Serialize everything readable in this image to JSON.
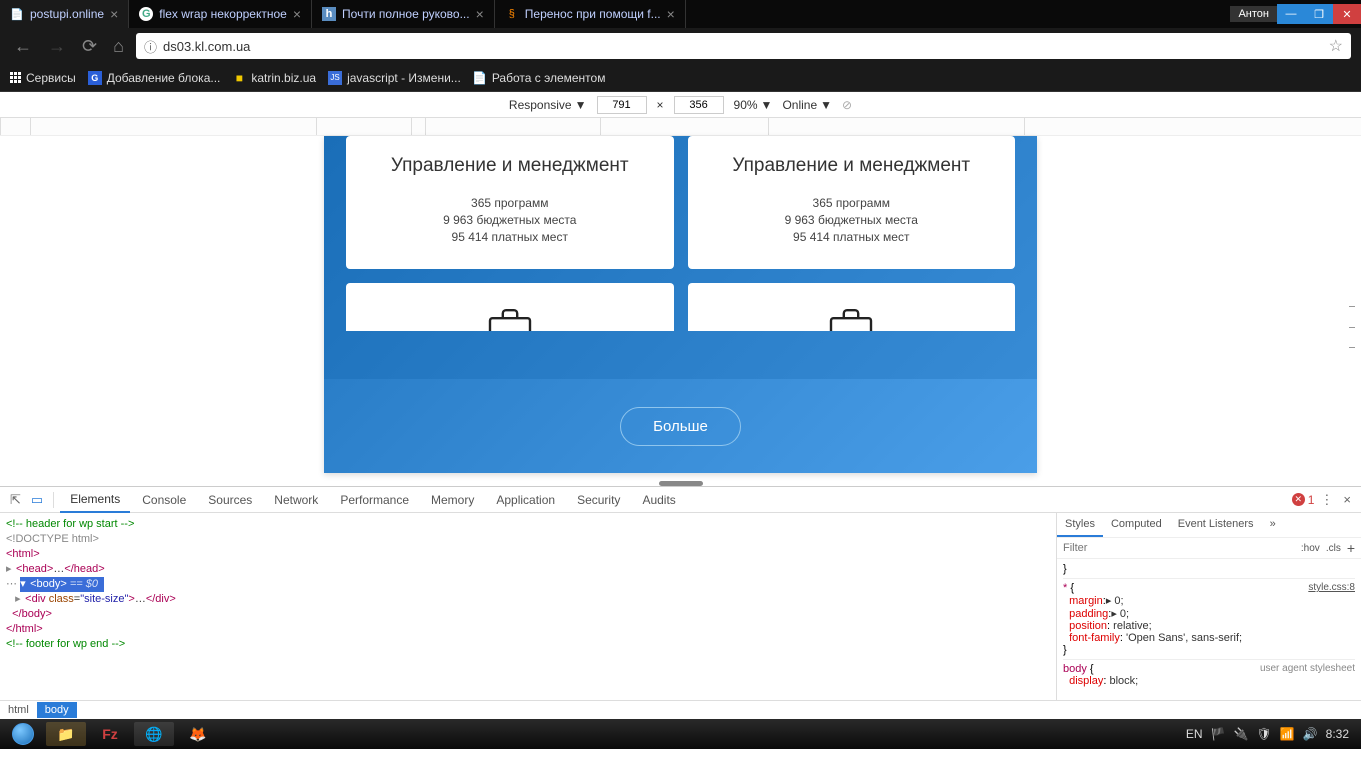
{
  "browser": {
    "tabs": [
      {
        "title": "postupi.online",
        "favicon": "📄",
        "color": "#4da0ff"
      },
      {
        "title": "flex wrap некорректное",
        "favicon": "G",
        "color": "#fff"
      },
      {
        "title": "Почти полное руково...",
        "favicon": "h",
        "color": "#fff"
      },
      {
        "title": "Перенос при помощи f...",
        "favicon": "§",
        "color": "#fff"
      }
    ],
    "user": "Антон",
    "url": "ds03.kl.com.ua",
    "bookmarks": {
      "services": "Сервисы",
      "items": [
        {
          "label": "Добавление блока...",
          "icon": "G",
          "iconBg": "#2a5fd8"
        },
        {
          "label": "katrin.biz.ua",
          "icon": "■",
          "iconBg": "#f0c800"
        },
        {
          "label": "javascript - Измени...",
          "icon": "JS",
          "iconBg": "#3a6dd8"
        },
        {
          "label": "Работа с элементом",
          "icon": "📄",
          "iconBg": "transparent"
        }
      ]
    }
  },
  "deviceToolbar": {
    "preset": "Responsive",
    "width": "791",
    "height": "356",
    "zoom": "90%",
    "network": "Online"
  },
  "page": {
    "card1": {
      "title": "Управление и менеджмент",
      "stat1": "365 программ",
      "stat2": "9 963 бюджетных места",
      "stat3": "95 414 платных мест"
    },
    "card2": {
      "title": "Управление и менеджмент",
      "stat1": "365 программ",
      "stat2": "9 963 бюджетных места",
      "stat3": "95 414 платных мест"
    },
    "moreBtn": "Больше"
  },
  "devtools": {
    "tabs": [
      "Elements",
      "Console",
      "Sources",
      "Network",
      "Performance",
      "Memory",
      "Application",
      "Security",
      "Audits"
    ],
    "errorCount": "1",
    "elements": {
      "comment1": "<!-- header for wp start -->",
      "doctype": "<!DOCTYPE html>",
      "htmlOpen": "<html>",
      "headLine": "<head>…</head>",
      "bodyLine": "<body>",
      "bodyDim": " == $0",
      "divLine": "<div class=\"site-size\">…</div>",
      "bodyClose": "</body>",
      "htmlClose": "</html>",
      "comment2": "<!-- footer for wp end -->"
    },
    "breadcrumb": {
      "html": "html",
      "body": "body"
    },
    "styles": {
      "tabs": [
        "Styles",
        "Computed",
        "Event Listeners"
      ],
      "filter": "Filter",
      "hov": ":hov",
      "cls": ".cls",
      "ruleLink": "style.css:8",
      "selector1": "* {",
      "margin": "margin",
      "marginVal": "▸ 0;",
      "padding": "padding",
      "paddingVal": "▸ 0;",
      "position": "position",
      "positionVal": "relative;",
      "fontFamily": "font-family",
      "fontFamilyVal": "'Open Sans', sans-serif;",
      "closeBrace": "}",
      "selector2": "body {",
      "uaComment": "user agent stylesheet",
      "display": "display",
      "displayVal": "block;"
    }
  },
  "taskbar": {
    "lang": "EN",
    "time": "8:32"
  }
}
